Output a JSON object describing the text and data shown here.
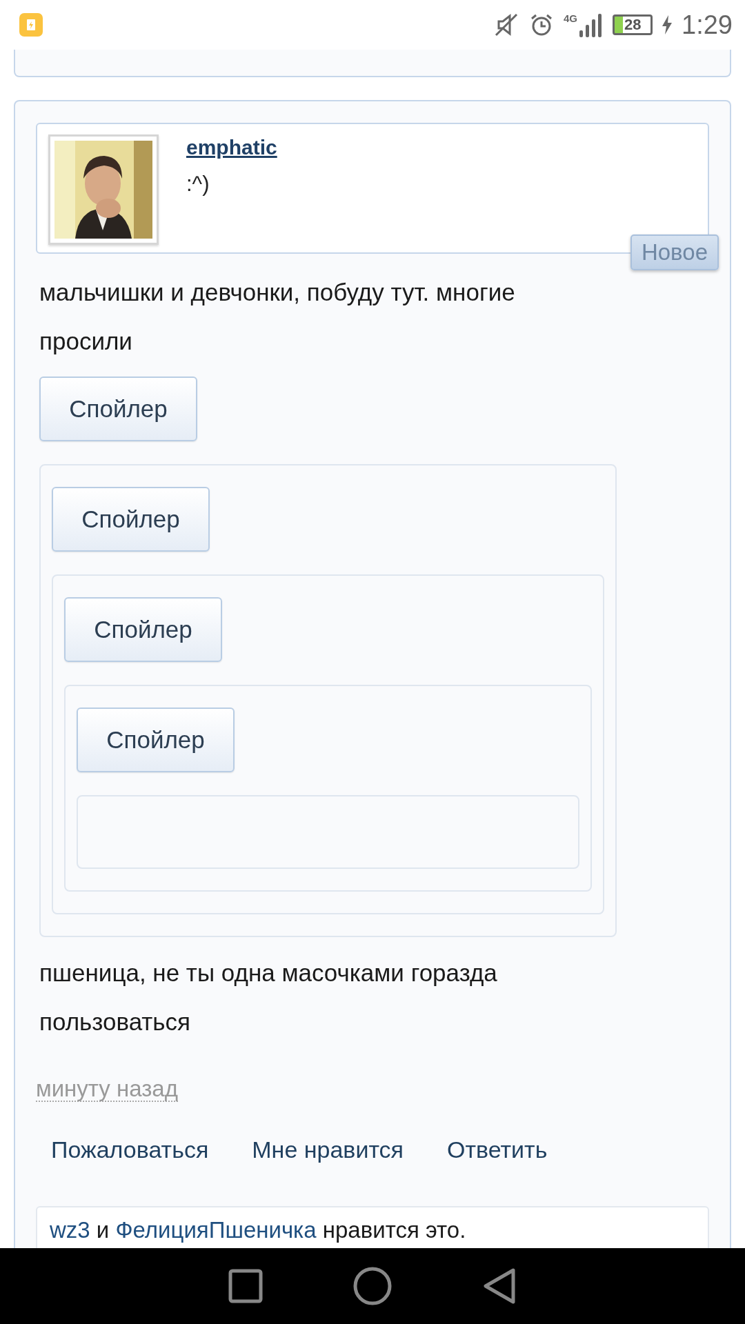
{
  "status_bar": {
    "network": "4G",
    "battery": "28",
    "time": "1:29"
  },
  "post": {
    "author": {
      "name": "emphatic",
      "status": ":^)"
    },
    "badge": "Новое",
    "body": [
      {
        "kind": "text",
        "text": "мальчишки и девчонки, побуду тут. многие просили"
      },
      {
        "kind": "spoiler",
        "label": "Спойлер",
        "child": {
          "label": "Спойлер",
          "child": {
            "label": "Спойлер",
            "child": {
              "label": "Спойлер"
            }
          }
        }
      },
      {
        "kind": "text",
        "text": "пшеница, не ты одна масочками горазда пользоваться"
      }
    ],
    "time": "минуту назад",
    "actions": [
      "Пожаловаться",
      "Мне нравится",
      "Ответить"
    ],
    "likes": {
      "users": [
        "wz3",
        "ФелицияПшеничка"
      ],
      "joiner": "и",
      "suffix": "нравится это."
    }
  }
}
